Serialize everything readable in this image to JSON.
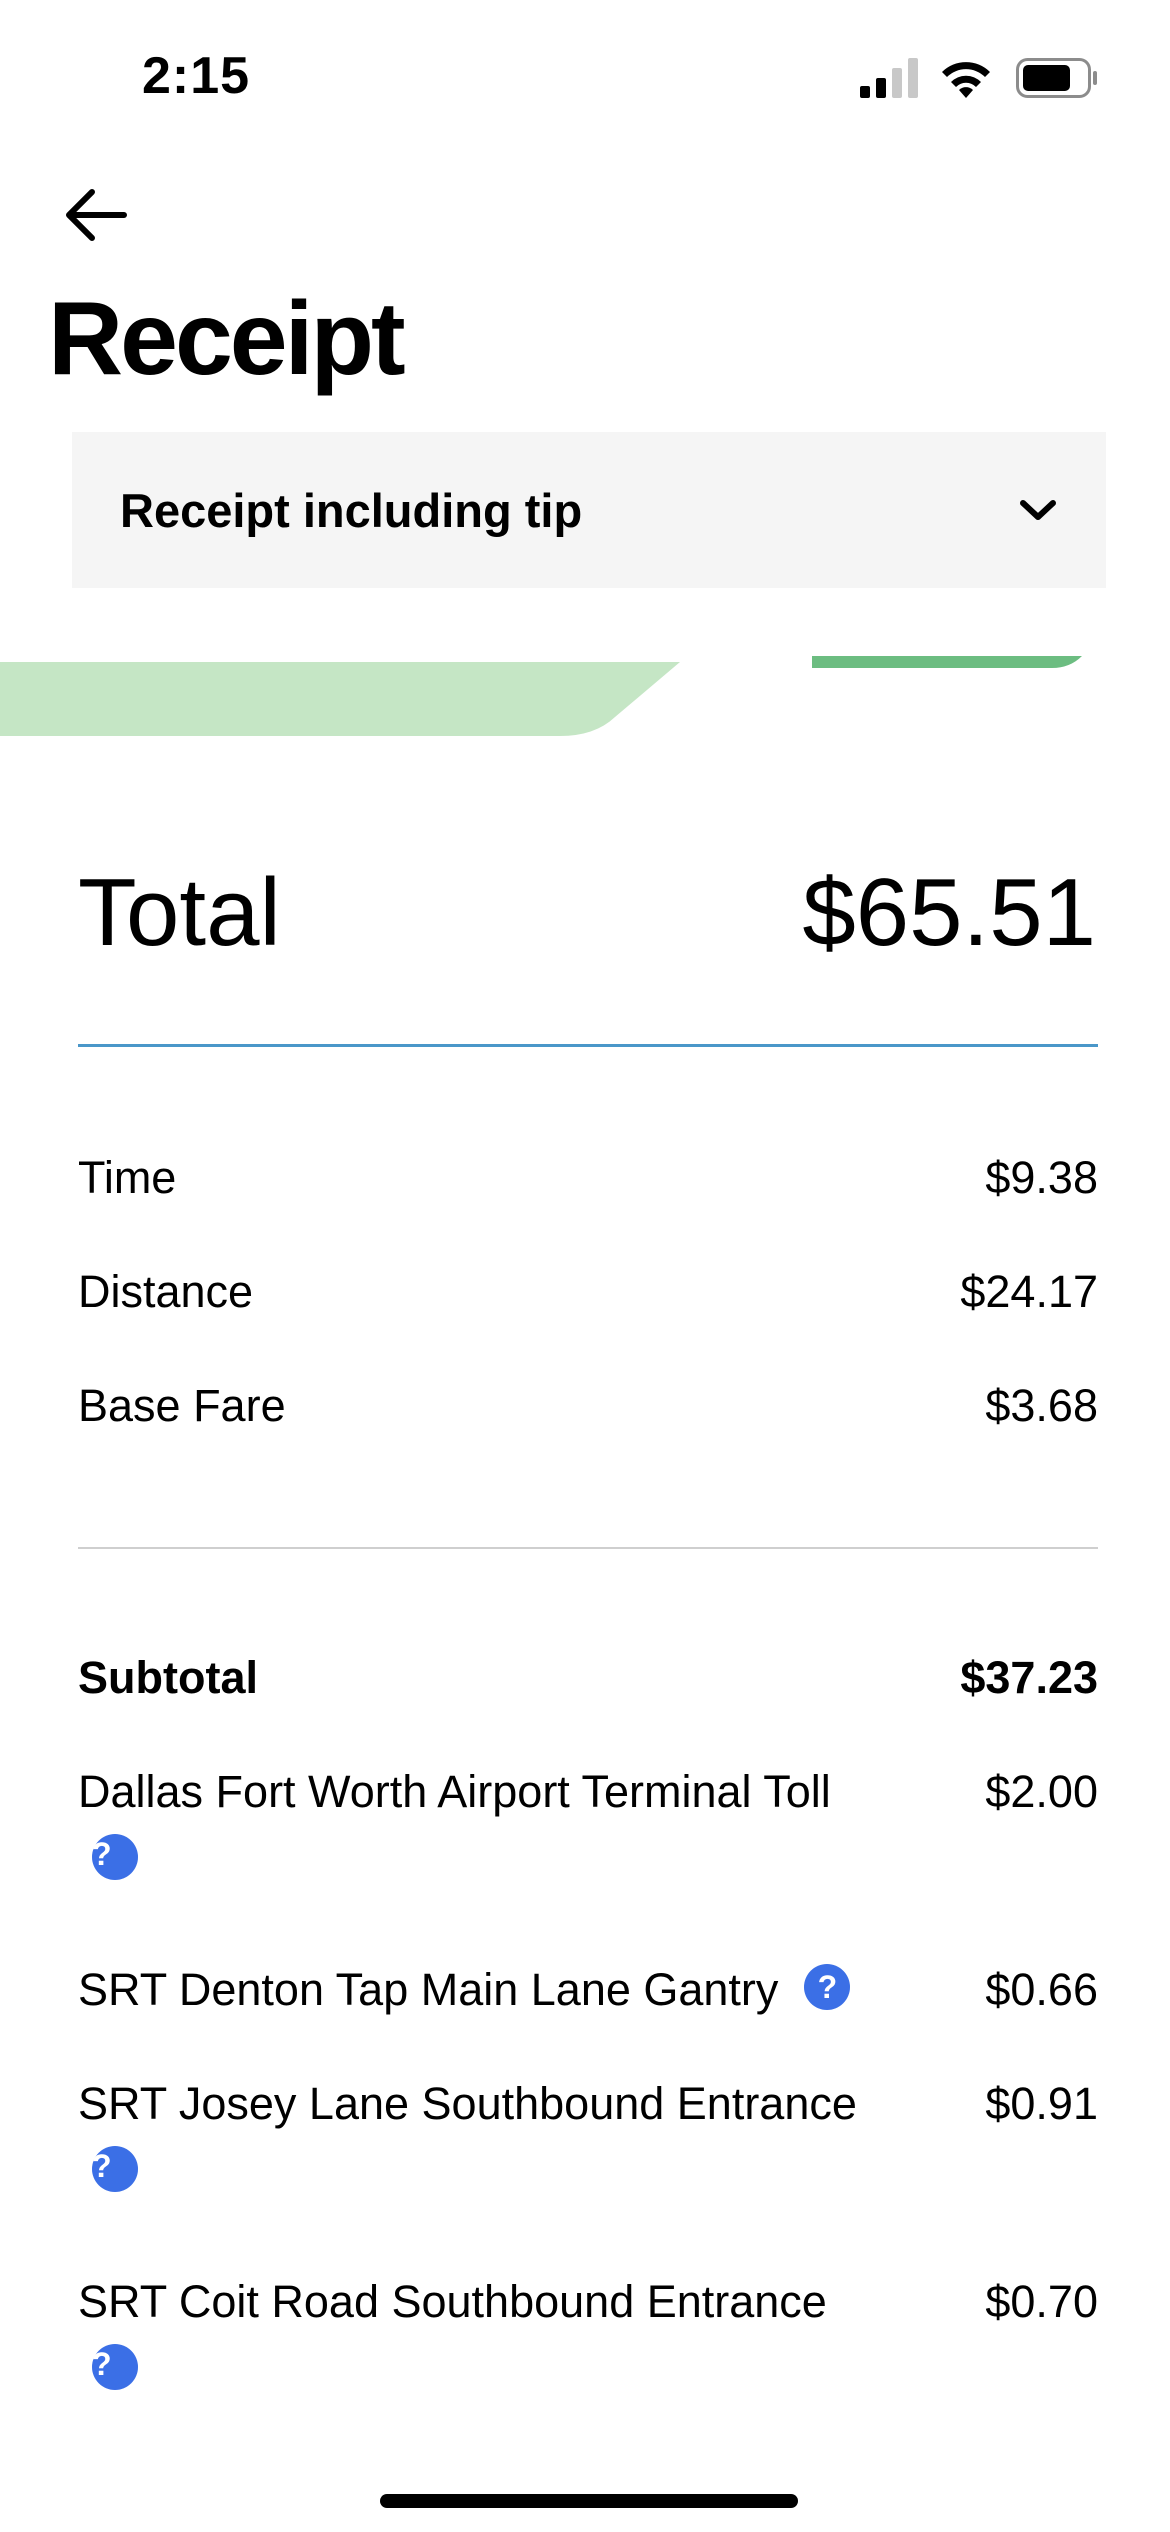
{
  "status_bar": {
    "time": "2:15"
  },
  "header": {
    "title": "Receipt"
  },
  "dropdown": {
    "label": "Receipt including tip"
  },
  "total": {
    "label": "Total",
    "amount": "$65.51"
  },
  "fare_items": [
    {
      "label": "Time",
      "amount": "$9.38"
    },
    {
      "label": "Distance",
      "amount": "$24.17"
    },
    {
      "label": "Base Fare",
      "amount": "$3.68"
    }
  ],
  "subtotal": {
    "label": "Subtotal",
    "amount": "$37.23"
  },
  "tolls": [
    {
      "label": "Dallas Fort Worth Airport Terminal Toll",
      "amount": "$2.00"
    },
    {
      "label": "SRT Denton Tap Main Lane Gantry",
      "amount": "$0.66"
    },
    {
      "label": "SRT Josey Lane Southbound Entrance",
      "amount": "$0.91"
    },
    {
      "label": "SRT Coit Road Southbound Entrance",
      "amount": "$0.70"
    }
  ],
  "help_icon_glyph": "?",
  "colors": {
    "accent_green": "#c5e6c5",
    "green_line": "#6cbd81",
    "blue_rule": "#4a97c9",
    "help_blue": "#3b6fe6"
  },
  "icons": [
    "back-arrow-icon",
    "chevron-down-icon",
    "help-icon",
    "signal-icon",
    "wifi-icon",
    "battery-icon"
  ]
}
